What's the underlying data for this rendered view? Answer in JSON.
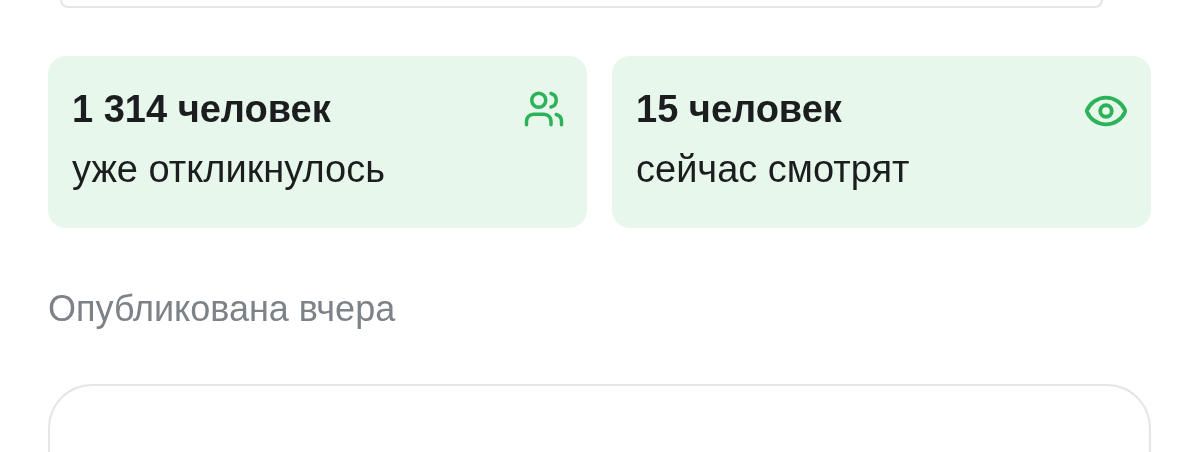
{
  "stats": [
    {
      "kind": "people",
      "value": "1 314 человек",
      "caption": "уже откликнулось"
    },
    {
      "kind": "views",
      "value": "15 человек",
      "caption": "сейчас смотрят"
    }
  ],
  "published": "Опубликована вчера"
}
